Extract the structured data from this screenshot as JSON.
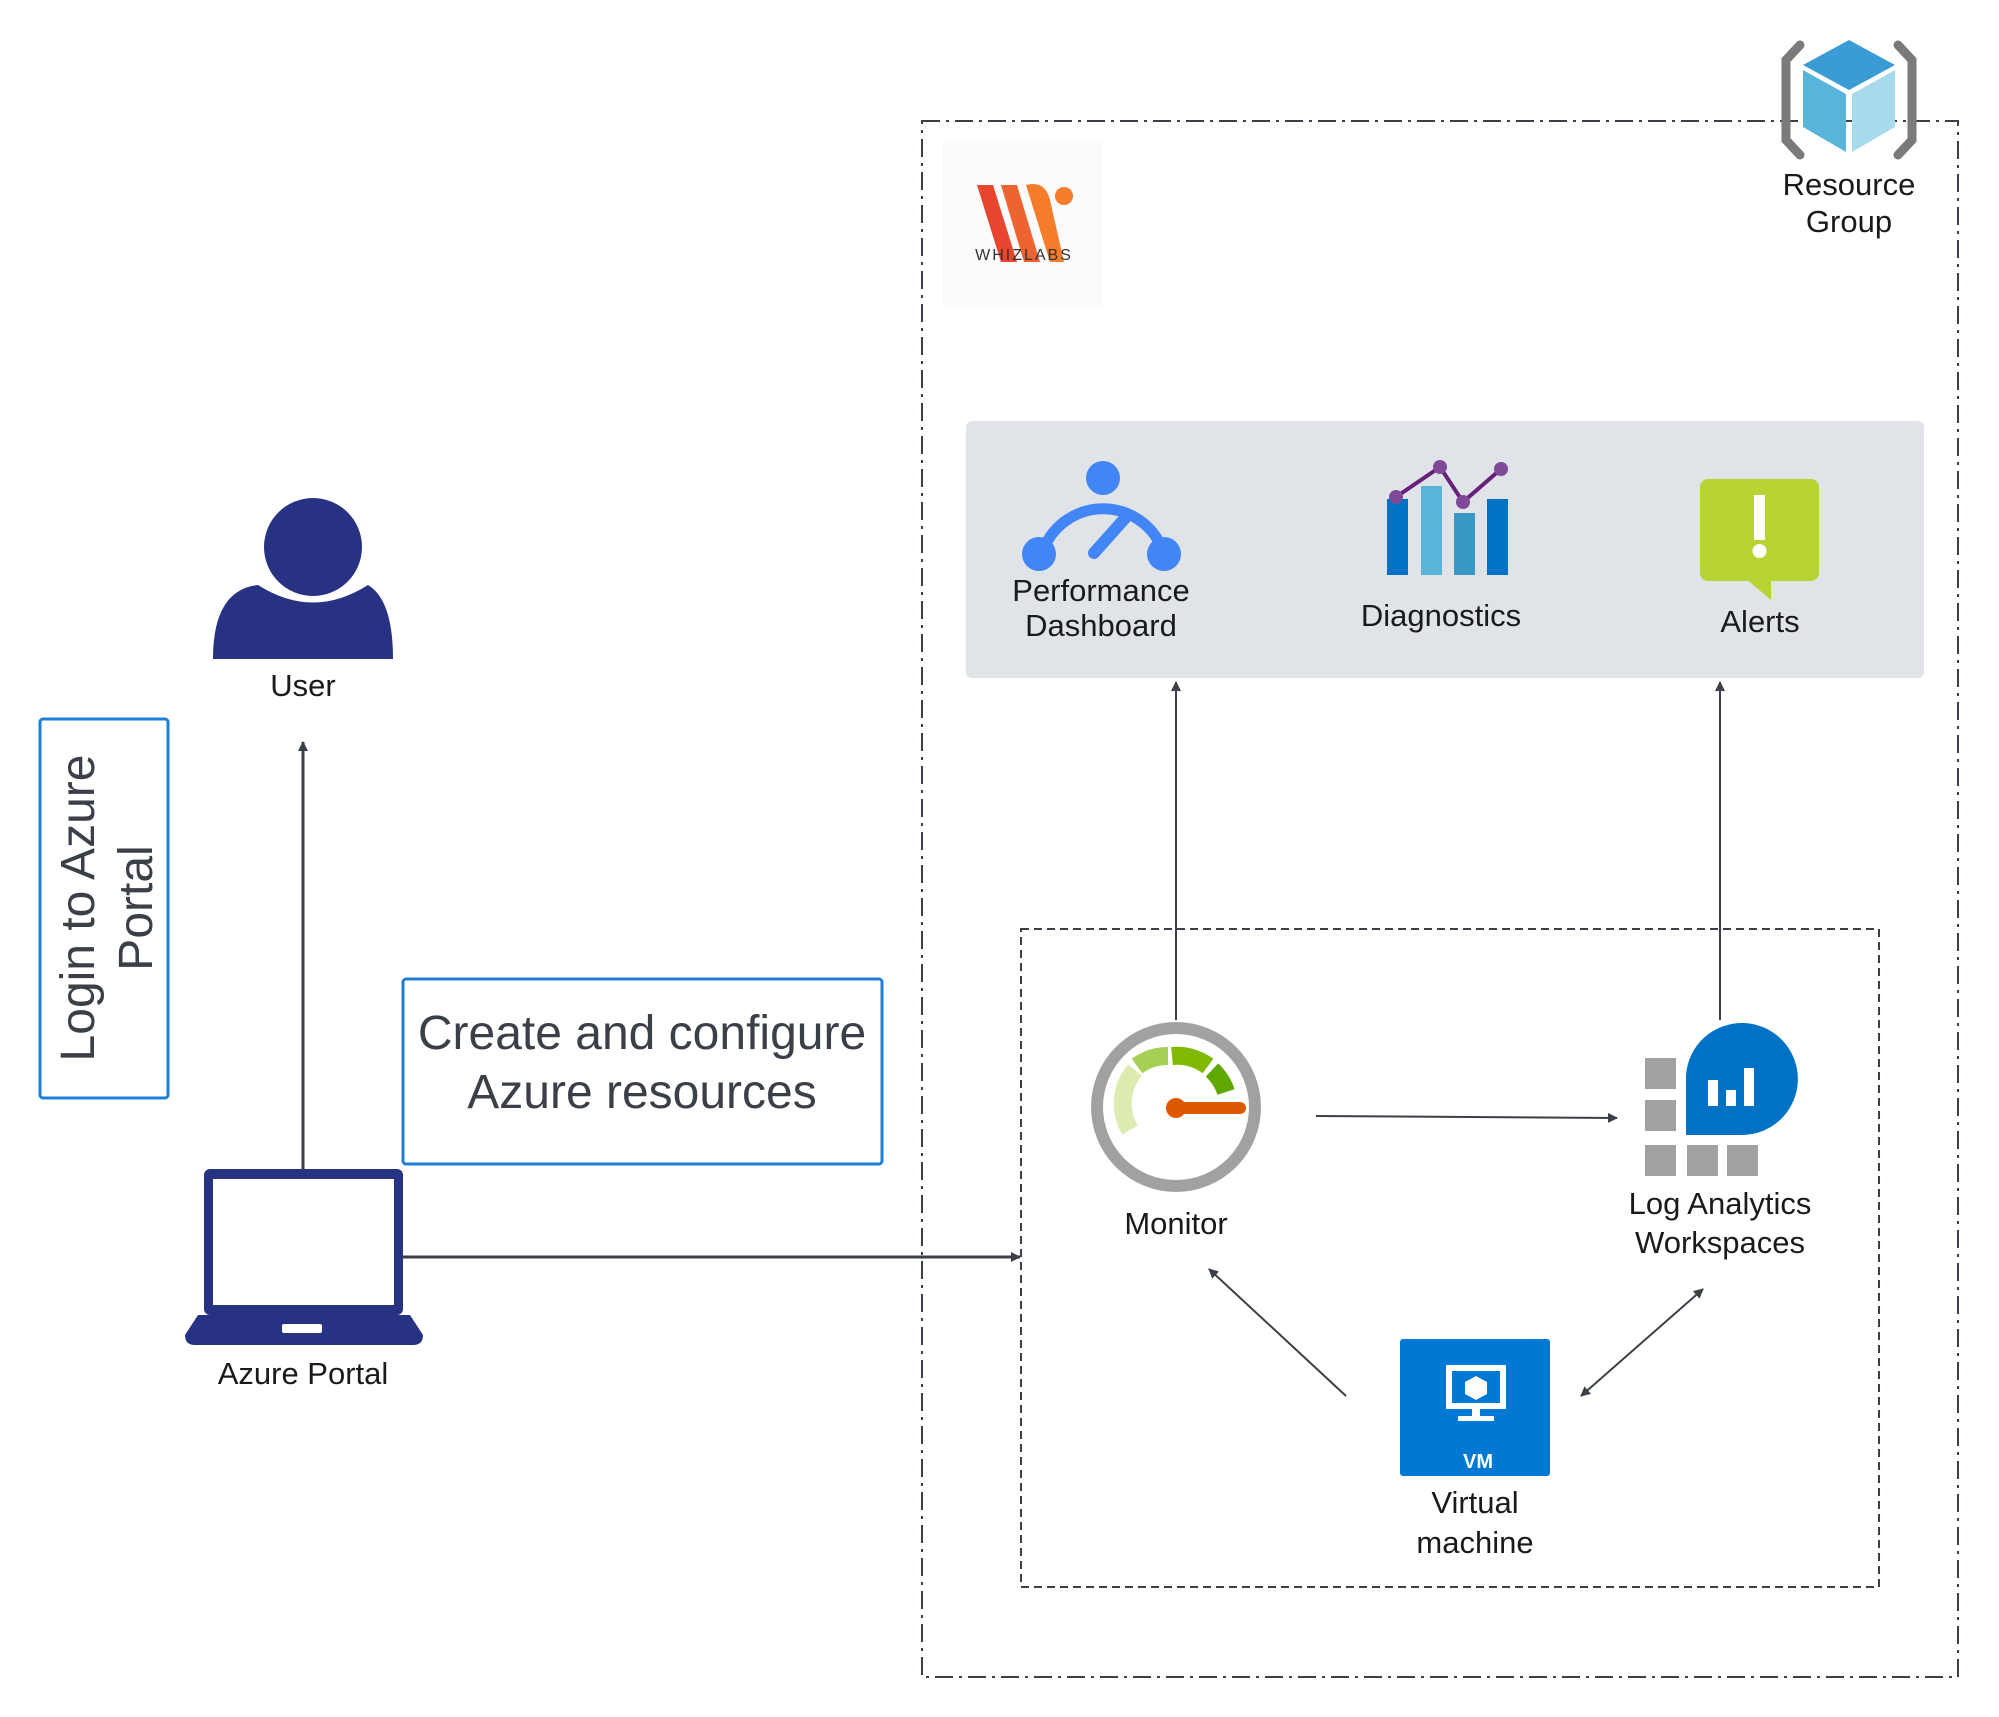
{
  "logo": {
    "text": "WHIZLABS",
    "colors": [
      "#e8452e",
      "#f47c2a"
    ]
  },
  "resource_group": {
    "line1": "Resource",
    "line2": "Group"
  },
  "services_panel": {
    "performance": {
      "line1": "Performance",
      "line2": "Dashboard"
    },
    "diagnostics": {
      "label": "Diagnostics"
    },
    "alerts": {
      "label": "Alerts"
    }
  },
  "user": {
    "label": "User"
  },
  "login_note": {
    "line1": "Login to Azure",
    "line2": "Portal"
  },
  "create_note": {
    "line1": "Create and configure",
    "line2": "Azure resources"
  },
  "azure_portal": {
    "label": "Azure Portal"
  },
  "monitor": {
    "label": "Monitor"
  },
  "log_analytics": {
    "line1": "Log Analytics",
    "line2": "Workspaces"
  },
  "vm": {
    "line1": "Virtual",
    "line2": "machine",
    "badge": "VM"
  },
  "colors": {
    "navy": "#283283",
    "azure_blue": "#0078d4",
    "note_border": "#1e7fd8",
    "panel": "#e0e3e8",
    "arrow": "#3b3f47"
  }
}
